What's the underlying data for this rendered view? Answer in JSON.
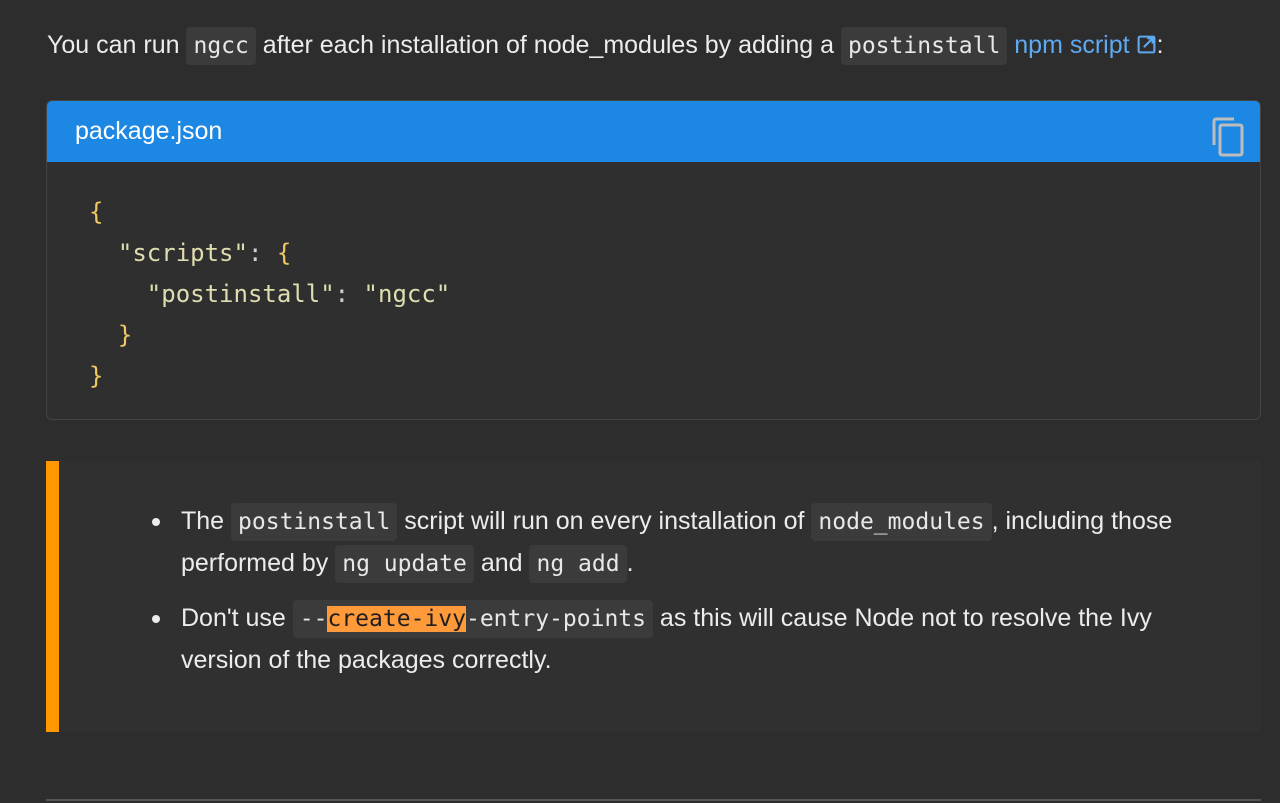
{
  "intro": {
    "text_1": "You can run ",
    "code_1": "ngcc",
    "text_2": " after each installation of node_modules by adding a ",
    "code_2": "postinstall",
    "link": "npm script",
    "text_3": ":"
  },
  "code_block": {
    "filename": "package.json",
    "lines": {
      "l1": "{",
      "l2_key": "\"scripts\"",
      "l2_colon": ": ",
      "l2_brace": "{",
      "l3_key": "\"postinstall\"",
      "l3_colon": ": ",
      "l3_val": "\"ngcc\"",
      "l4": "}",
      "l5": "}"
    },
    "copy_icon": "copy-icon"
  },
  "callout": {
    "accent_color": "#ff9800",
    "item1": {
      "t1": "The ",
      "c1": "postinstall",
      "t2": " script will run on every installation of ",
      "c2": "node_modules",
      "t3": ", including those performed by ",
      "c3": "ng update",
      "t4": " and ",
      "c4": "ng add",
      "t5": "."
    },
    "item2": {
      "t1": "Don't use ",
      "c1a": "--",
      "c1b": "create-ivy",
      "c1c": "-entry-points",
      "t2": " as this will cause Node not to resolve the Ivy version of the packages correctly."
    }
  },
  "colors": {
    "background": "#2d2d2d",
    "header_blue": "#1d87e4",
    "link_blue": "#5ea9f0",
    "highlight": "#ff9a3b"
  }
}
